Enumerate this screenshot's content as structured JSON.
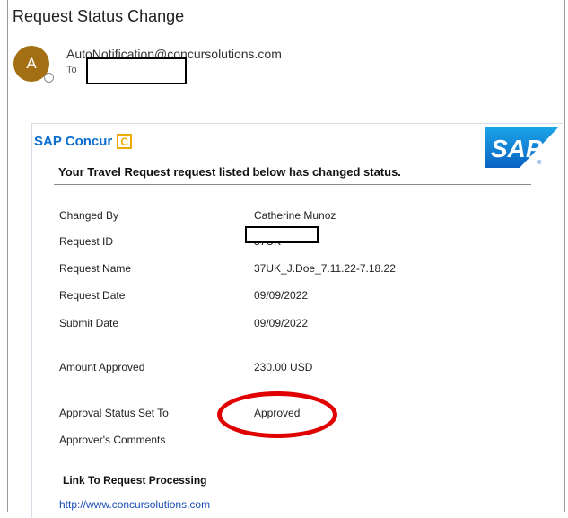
{
  "header": {
    "subject": "Request Status Change",
    "avatar_initial": "A",
    "sender": "AutoNotification@concursolutions.com",
    "to_label": "To"
  },
  "brand": {
    "concur_text": "SAP Concur",
    "concur_c": "C",
    "sap_text": "SAP",
    "accent_blue": "#0a6ed1",
    "concur_orange": "#f0ab00",
    "avatar_color": "#a46f12"
  },
  "email": {
    "headline": "Your Travel Request request listed below has changed status.",
    "fields": {
      "changed_by_label": "Changed By",
      "changed_by_value": "Catherine Munoz",
      "request_id_label": "Request ID",
      "request_id_value": "37UK",
      "request_name_label": "Request Name",
      "request_name_value": "37UK_J.Doe_7.11.22-7.18.22",
      "request_date_label": "Request Date",
      "request_date_value": "09/09/2022",
      "submit_date_label": "Submit Date",
      "submit_date_value": "09/09/2022",
      "amount_label": "Amount Approved",
      "amount_value": "230.00 USD",
      "status_label": "Approval Status Set To",
      "status_value": "Approved",
      "comments_label": "Approver's Comments"
    },
    "link_title": "Link To Request Processing",
    "link_url": "http://www.concursolutions.com"
  }
}
